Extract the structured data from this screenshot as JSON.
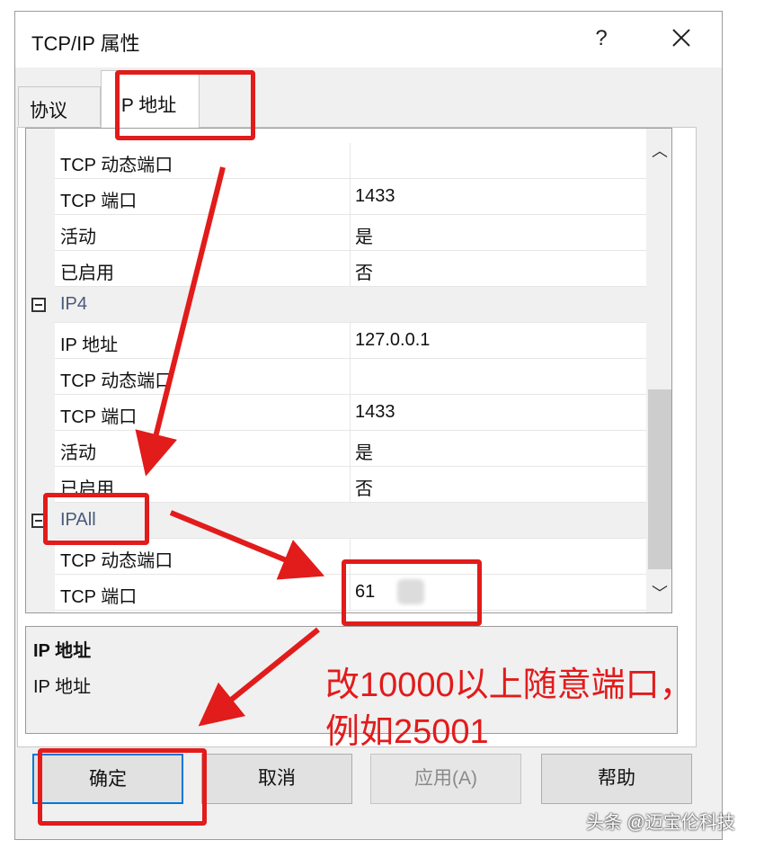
{
  "dialog": {
    "title": "TCP/IP 属性",
    "help": "?",
    "close_icon": "close-icon"
  },
  "tabs": [
    {
      "label": "协议",
      "active": false
    },
    {
      "label": "IP 地址",
      "active": true
    }
  ],
  "grid": {
    "rows": [
      {
        "kind": "prop",
        "name": "TCP 动态端口",
        "value": ""
      },
      {
        "kind": "prop",
        "name": "TCP 端口",
        "value": "1433"
      },
      {
        "kind": "prop",
        "name": "活动",
        "value": "是"
      },
      {
        "kind": "prop",
        "name": "已启用",
        "value": "否"
      },
      {
        "kind": "category",
        "name": "IP4",
        "value": ""
      },
      {
        "kind": "prop",
        "name": "IP 地址",
        "value": "127.0.0.1"
      },
      {
        "kind": "prop",
        "name": "TCP 动态端口",
        "value": ""
      },
      {
        "kind": "prop",
        "name": "TCP 端口",
        "value": "1433"
      },
      {
        "kind": "prop",
        "name": "活动",
        "value": "是"
      },
      {
        "kind": "prop",
        "name": "已启用",
        "value": "否"
      },
      {
        "kind": "category",
        "name": "IPAll",
        "value": ""
      },
      {
        "kind": "prop",
        "name": "TCP 动态端口",
        "value": ""
      },
      {
        "kind": "prop",
        "name": "TCP 端口",
        "value": "61"
      }
    ]
  },
  "description": {
    "title": "IP 地址",
    "text": "IP 地址"
  },
  "buttons": {
    "ok": "确定",
    "cancel": "取消",
    "apply": "应用(A)",
    "help": "帮助"
  },
  "annotation": {
    "line1": "改10000以上随意端口，",
    "line2": "例如25001",
    "color": "#e21b1b"
  },
  "watermark": "头条 @迈宝伦科技"
}
